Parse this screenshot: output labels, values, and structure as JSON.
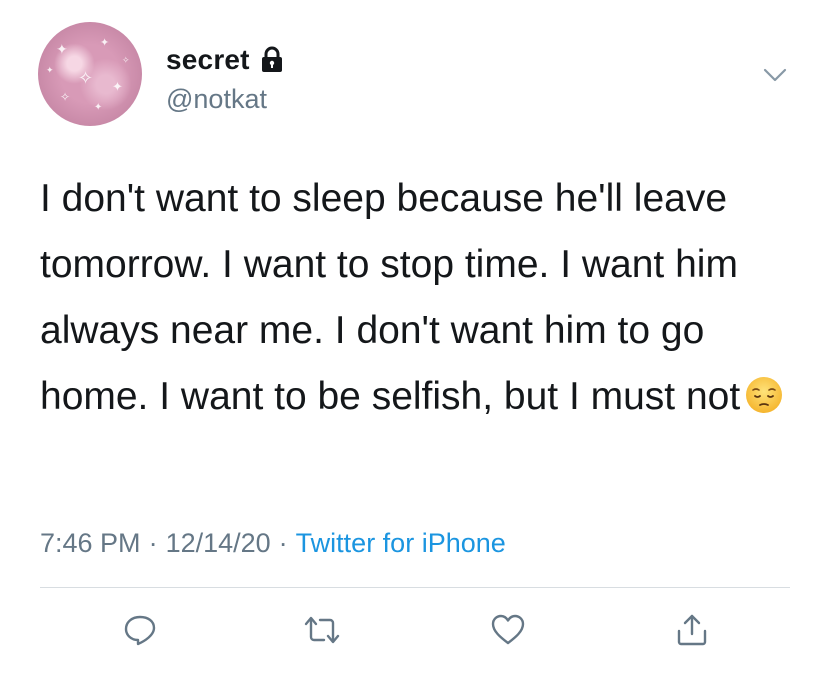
{
  "user": {
    "display_name": "secret",
    "handle": "@notkat",
    "protected_icon": "lock-icon",
    "avatar_icon": "sparkle-avatar"
  },
  "tweet": {
    "text": "I don't want to sleep because he'll leave tomorrow. I want to stop time. I want him always near me. I don't want him to go home. I want to be selfish, but I must not",
    "emoji": "pensive-face-emoji",
    "time": "7:46 PM",
    "separator": "·",
    "date": "12/14/20",
    "source": "Twitter for iPhone"
  },
  "actions": {
    "reply_icon": "reply-icon",
    "retweet_icon": "retweet-icon",
    "like_icon": "heart-icon",
    "share_icon": "share-icon"
  },
  "colors": {
    "text": "#14171a",
    "secondary": "#657786",
    "link": "#1b95e0",
    "icon": "#657786"
  }
}
